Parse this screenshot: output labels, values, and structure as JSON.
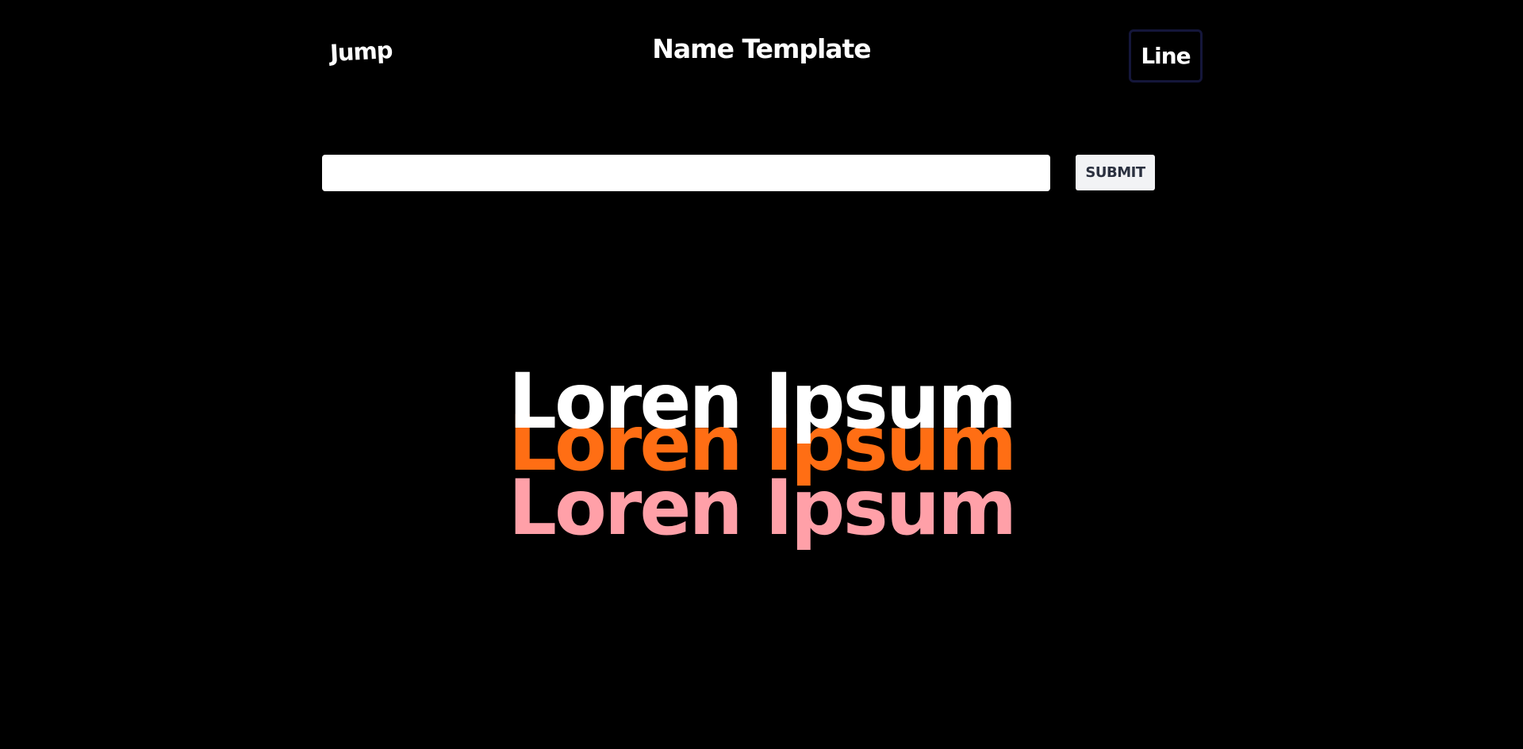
{
  "header": {
    "jump_label": "Jump",
    "title": "Name Template",
    "line_label": "Line"
  },
  "form": {
    "input_value": "",
    "input_placeholder": "",
    "submit_label": "SUBMIT"
  },
  "preview": {
    "lines": [
      {
        "text": "Loren Ipsum",
        "color": "#ffffff"
      },
      {
        "text": "Loren Ipsum",
        "color": "#ff6e14"
      },
      {
        "text": "Loren Ipsum",
        "color": "#ffa0a8"
      }
    ]
  }
}
